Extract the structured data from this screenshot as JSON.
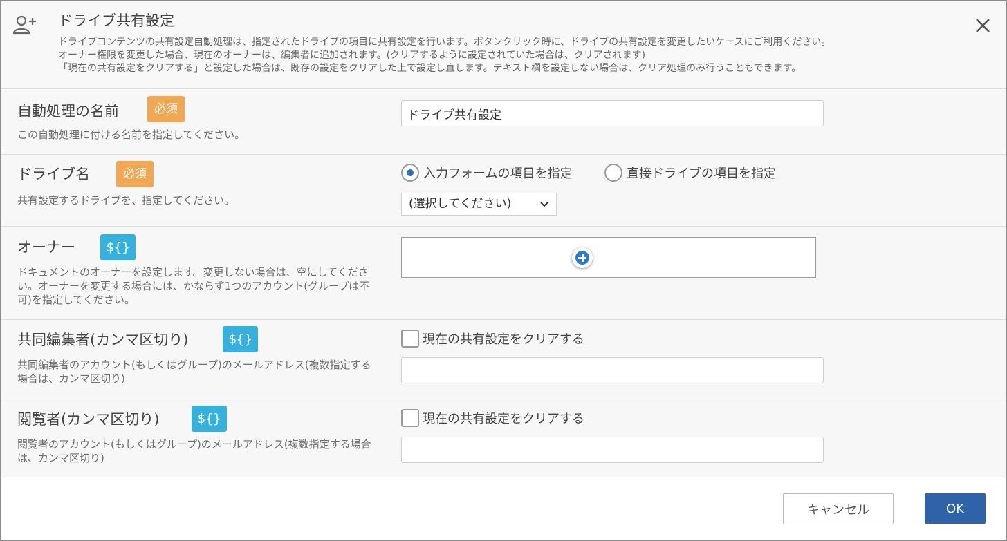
{
  "header": {
    "title": "ドライブ共有設定",
    "icon": "add-user-icon",
    "description": [
      "ドライブコンテンツの共有設定自動処理は、指定されたドライブの項目に共有設定を行います。ボタンクリック時に、ドライブの共有設定を変更したいケースにご利用ください。",
      "オーナー権限を変更した場合、現在のオーナーは、編集者に追加されます。(クリアするように設定されていた場合は、クリアされます)",
      "「現在の共有設定をクリアする」と設定した場合は、既存の設定をクリアした上で設定し直します。テキスト欄を設定しない場合は、クリア処理のみ行うこともできます。"
    ]
  },
  "badges": {
    "required": "必須",
    "variable": "${}"
  },
  "fields": {
    "name": {
      "label": "自動処理の名前",
      "description": "この自動処理に付ける名前を指定してください。",
      "value": "ドライブ共有設定"
    },
    "drive": {
      "label": "ドライブ名",
      "description": "共有設定するドライブを、指定してください。",
      "radio_form": "入力フォームの項目を指定",
      "radio_direct": "直接ドライブの項目を指定",
      "selected_radio": "radio_form",
      "select_value": "(選択してください)"
    },
    "owner": {
      "label": "オーナー",
      "description": "ドキュメントのオーナーを設定します。変更しない場合は、空にしてください。オーナーを変更する場合には、かならず1つのアカウント(グループは不可)を指定してください。"
    },
    "editors": {
      "label": "共同編集者(カンマ区切り)",
      "description": "共同編集者のアカウント(もしくはグループ)のメールアドレス(複数指定する場合は、カンマ区切り)",
      "clear_label": "現在の共有設定をクリアする",
      "value": ""
    },
    "viewers": {
      "label": "閲覧者(カンマ区切り)",
      "description": "閲覧者のアカウント(もしくはグループ)のメールアドレス(複数指定する場合は、カンマ区切り)",
      "clear_label": "現在の共有設定をクリアする",
      "value": ""
    }
  },
  "footer": {
    "cancel_label": "キャンセル",
    "ok_label": "OK"
  },
  "colors": {
    "required_badge": "#f0a854",
    "variable_badge": "#36b0dc",
    "primary": "#2e62a9",
    "radio_checked": "#2f6fb3"
  }
}
